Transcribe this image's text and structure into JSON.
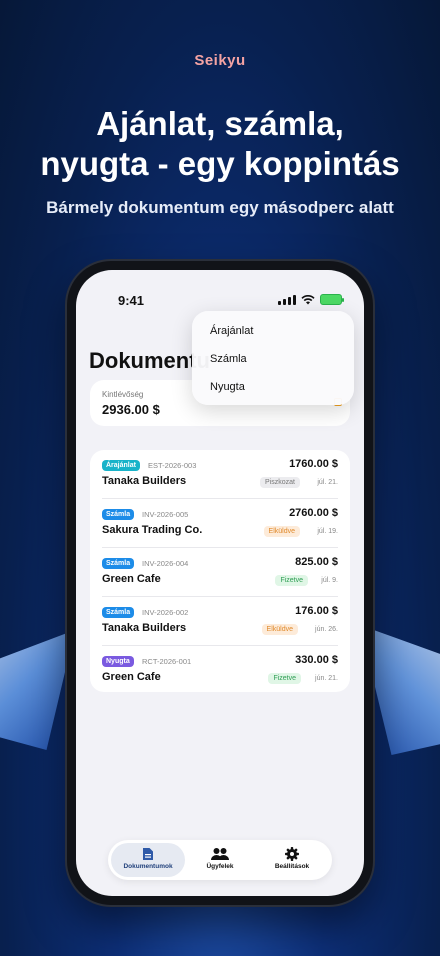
{
  "brand": "Seikyu",
  "headline": {
    "line1": "Ajánlat, számla,",
    "line2": "nyugta - egy koppintás"
  },
  "subline": "Bármely dokumentum egy másodperc alatt",
  "phone": {
    "status_time": "9:41",
    "page_title": "Dokumentumok",
    "summary": {
      "label": "Kintlévőség",
      "value": "2936.00 $"
    },
    "dropdown": {
      "items": [
        "Árajánlat",
        "Számla",
        "Nyugta"
      ]
    },
    "documents": [
      {
        "type": "Árajánlat",
        "type_color": "#19b3c9",
        "id": "EST-2026-003",
        "client": "Tanaka Builders",
        "amount": "1760.00 $",
        "status": "Piszkozat",
        "status_bg": "#ececef",
        "status_fg": "#777777",
        "date": "júl. 21."
      },
      {
        "type": "Számla",
        "type_color": "#1d8ce8",
        "id": "INV-2026-005",
        "client": "Sakura Trading Co.",
        "amount": "2760.00 $",
        "status": "Elküldve",
        "status_bg": "#fdebd9",
        "status_fg": "#e08a2c",
        "date": "júl. 19."
      },
      {
        "type": "Számla",
        "type_color": "#1d8ce8",
        "id": "INV-2026-004",
        "client": "Green Cafe",
        "amount": "825.00 $",
        "status": "Fizetve",
        "status_bg": "#e0f6e6",
        "status_fg": "#2f9e54",
        "date": "júl. 9."
      },
      {
        "type": "Számla",
        "type_color": "#1d8ce8",
        "id": "INV-2026-002",
        "client": "Tanaka Builders",
        "amount": "176.00 $",
        "status": "Elküldve",
        "status_bg": "#fdebd9",
        "status_fg": "#e08a2c",
        "date": "jún. 26."
      },
      {
        "type": "Nyugta",
        "type_color": "#7a5ae0",
        "id": "RCT-2026-001",
        "client": "Green Cafe",
        "amount": "330.00 $",
        "status": "Fizetve",
        "status_bg": "#e0f6e6",
        "status_fg": "#2f9e54",
        "date": "jún. 21."
      }
    ],
    "tabs": [
      {
        "label": "Dokumentumok",
        "icon": "document-icon",
        "active": true
      },
      {
        "label": "Ügyfelek",
        "icon": "people-icon",
        "active": false
      },
      {
        "label": "Beállítások",
        "icon": "gear-icon",
        "active": false
      }
    ]
  }
}
